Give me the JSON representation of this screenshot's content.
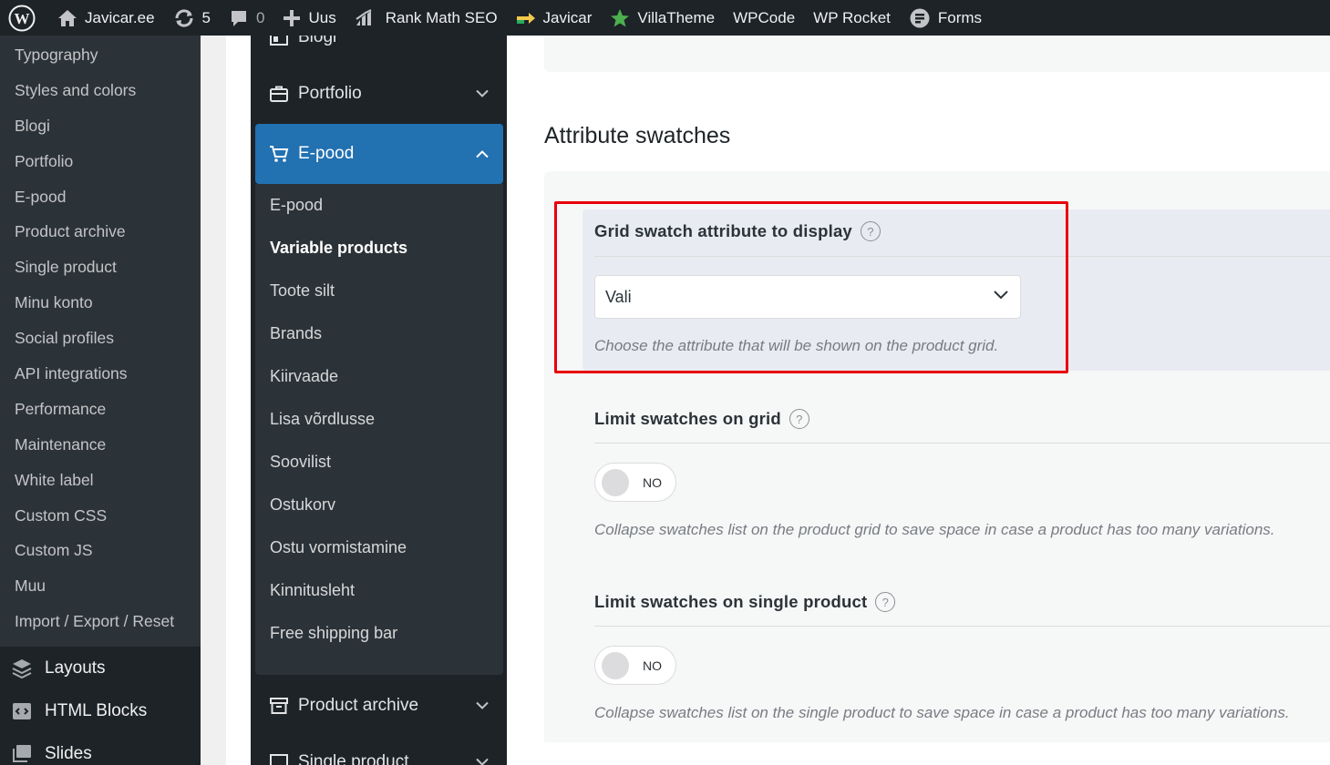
{
  "admin_bar": {
    "site_name": "Javicar.ee",
    "updates_count": "5",
    "comments_count": "0",
    "new_label": "Uus",
    "rank_math_label": "Rank Math SEO",
    "javicar_label": "Javicar",
    "villatheme_label": "VillaTheme",
    "wpcode_label": "WPCode",
    "wprocket_label": "WP Rocket",
    "forms_label": "Forms"
  },
  "wp_sidebar": {
    "submenu": [
      "Typography",
      "Styles and colors",
      "Blogi",
      "Portfolio",
      "E-pood",
      "Product archive",
      "Single product",
      "Minu konto",
      "Social profiles",
      "API integrations",
      "Performance",
      "Maintenance",
      "White label",
      "Custom CSS",
      "Custom JS",
      "Muu",
      "Import / Export / Reset"
    ],
    "menu": [
      {
        "label": "Layouts",
        "icon": "layers-icon"
      },
      {
        "label": "HTML Blocks",
        "icon": "code-block-icon"
      },
      {
        "label": "Slides",
        "icon": "slides-icon"
      }
    ]
  },
  "theme_nav": {
    "blog_partial": "Blogi",
    "portfolio": "Portfolio",
    "epood": "E-pood",
    "epood_items": [
      "E-pood",
      "Variable products",
      "Toote silt",
      "Brands",
      "Kiirvaade",
      "Lisa võrdlusse",
      "Soovilist",
      "Ostukorv",
      "Ostu vormistamine",
      "Kinnitusleht",
      "Free shipping bar"
    ],
    "current_item": "Variable products",
    "product_archive": "Product archive",
    "single_product_partial": "Single product"
  },
  "main": {
    "section_title": "Attribute swatches",
    "grid_swatch": {
      "label": "Grid swatch attribute to display",
      "select_value": "Vali",
      "description": "Choose the attribute that will be shown on the product grid."
    },
    "limit_grid": {
      "label": "Limit swatches on grid",
      "toggle_text": "NO",
      "description": "Collapse swatches list on the product grid to save space in case a product has too many variations."
    },
    "limit_single": {
      "label": "Limit swatches on single product",
      "toggle_text": "NO",
      "description": "Collapse swatches list on the single product to save space in case a product has too many variations."
    },
    "help_glyph": "?"
  },
  "colors": {
    "admin_bar_bg": "#1d2327",
    "sidebar_bg": "#2c3338",
    "accent": "#2271b1",
    "highlight_border": "#e8000b"
  }
}
